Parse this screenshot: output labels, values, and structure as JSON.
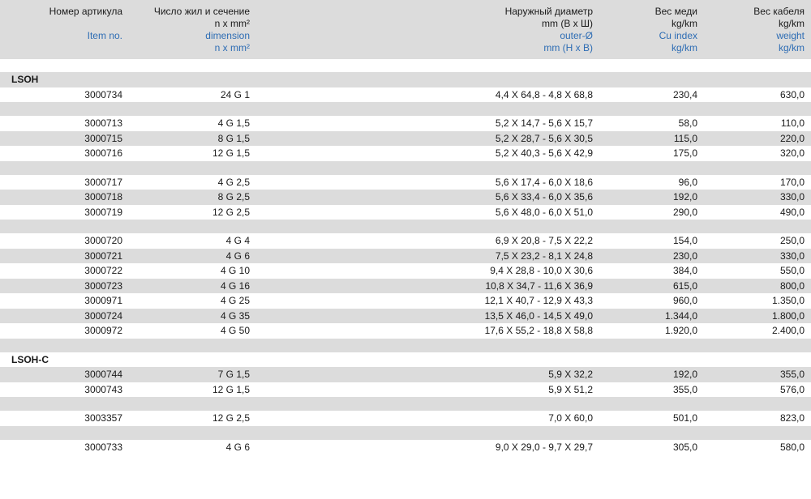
{
  "header": {
    "col1": {
      "ru": [
        "Номер артикула"
      ],
      "en": [
        "Item no."
      ]
    },
    "col2": {
      "ru": [
        "Число жил и сечение",
        "n x mm²"
      ],
      "en": [
        "dimension",
        "n x mm²"
      ]
    },
    "col3": {
      "ru": [
        "Наружный диаметр",
        "mm (В х Ш)"
      ],
      "en": [
        "outer-Ø",
        "mm (H x B)"
      ]
    },
    "col4": {
      "ru": [
        "Вес меди",
        "kg/km"
      ],
      "en": [
        "Cu index",
        "kg/km"
      ]
    },
    "col5": {
      "ru": [
        "Вес кабеля",
        "kg/km"
      ],
      "en": [
        "weight",
        "kg/km"
      ]
    }
  },
  "rows": [
    {
      "kind": "section",
      "label": "LSOH",
      "shade": "gray"
    },
    {
      "kind": "data",
      "shade": "white",
      "cells": [
        "3000734",
        "24 G 1",
        "4,4 X 64,8 - 4,8 X 68,8",
        "230,4",
        "630,0"
      ]
    },
    {
      "kind": "spacer"
    },
    {
      "kind": "data",
      "shade": "white",
      "cells": [
        "3000713",
        "4 G 1,5",
        "5,2 X 14,7 - 5,6 X 15,7",
        "58,0",
        "110,0"
      ]
    },
    {
      "kind": "data",
      "shade": "gray",
      "cells": [
        "3000715",
        "8 G 1,5",
        "5,2 X 28,7 - 5,6 X 30,5",
        "115,0",
        "220,0"
      ]
    },
    {
      "kind": "data",
      "shade": "white",
      "cells": [
        "3000716",
        "12 G 1,5",
        "5,2 X 40,3 - 5,6 X 42,9",
        "175,0",
        "320,0"
      ]
    },
    {
      "kind": "spacer"
    },
    {
      "kind": "data",
      "shade": "white",
      "cells": [
        "3000717",
        "4 G 2,5",
        "5,6 X 17,4 - 6,0 X 18,6",
        "96,0",
        "170,0"
      ]
    },
    {
      "kind": "data",
      "shade": "gray",
      "cells": [
        "3000718",
        "8 G 2,5",
        "5,6 X 33,4 - 6,0 X 35,6",
        "192,0",
        "330,0"
      ]
    },
    {
      "kind": "data",
      "shade": "white",
      "cells": [
        "3000719",
        "12 G 2,5",
        "5,6 X 48,0 - 6,0 X 51,0",
        "290,0",
        "490,0"
      ]
    },
    {
      "kind": "spacer"
    },
    {
      "kind": "data",
      "shade": "white",
      "cells": [
        "3000720",
        "4 G 4",
        "6,9 X 20,8 - 7,5 X 22,2",
        "154,0",
        "250,0"
      ]
    },
    {
      "kind": "data",
      "shade": "gray",
      "cells": [
        "3000721",
        "4 G 6",
        "7,5 X 23,2 - 8,1 X 24,8",
        "230,0",
        "330,0"
      ]
    },
    {
      "kind": "data",
      "shade": "white",
      "cells": [
        "3000722",
        "4 G 10",
        "9,4 X 28,8 - 10,0 X 30,6",
        "384,0",
        "550,0"
      ]
    },
    {
      "kind": "data",
      "shade": "gray",
      "cells": [
        "3000723",
        "4 G 16",
        "10,8 X 34,7 - 11,6 X 36,9",
        "615,0",
        "800,0"
      ]
    },
    {
      "kind": "data",
      "shade": "white",
      "cells": [
        "3000971",
        "4 G 25",
        "12,1 X 40,7 - 12,9 X 43,3",
        "960,0",
        "1.350,0"
      ]
    },
    {
      "kind": "data",
      "shade": "gray",
      "cells": [
        "3000724",
        "4 G 35",
        "13,5 X 46,0 - 14,5 X 49,0",
        "1.344,0",
        "1.800,0"
      ]
    },
    {
      "kind": "data",
      "shade": "white",
      "cells": [
        "3000972",
        "4 G 50",
        "17,6 X 55,2 - 18,8 X 58,8",
        "1.920,0",
        "2.400,0"
      ]
    },
    {
      "kind": "spacer"
    },
    {
      "kind": "section",
      "label": "LSOH-C",
      "shade": "white"
    },
    {
      "kind": "data",
      "shade": "gray",
      "cells": [
        "3000744",
        "7 G 1,5",
        "5,9 X 32,2",
        "192,0",
        "355,0"
      ]
    },
    {
      "kind": "data",
      "shade": "white",
      "cells": [
        "3000743",
        "12 G 1,5",
        "5,9 X 51,2",
        "355,0",
        "576,0"
      ]
    },
    {
      "kind": "spacer"
    },
    {
      "kind": "data",
      "shade": "white",
      "cells": [
        "3003357",
        "12 G 2,5",
        "7,0 X 60,0",
        "501,0",
        "823,0"
      ]
    },
    {
      "kind": "spacer"
    },
    {
      "kind": "data",
      "shade": "white",
      "cells": [
        "3000733",
        "4 G 6",
        "9,0 X 29,0 - 9,7 X 29,7",
        "305,0",
        "580,0"
      ]
    }
  ]
}
